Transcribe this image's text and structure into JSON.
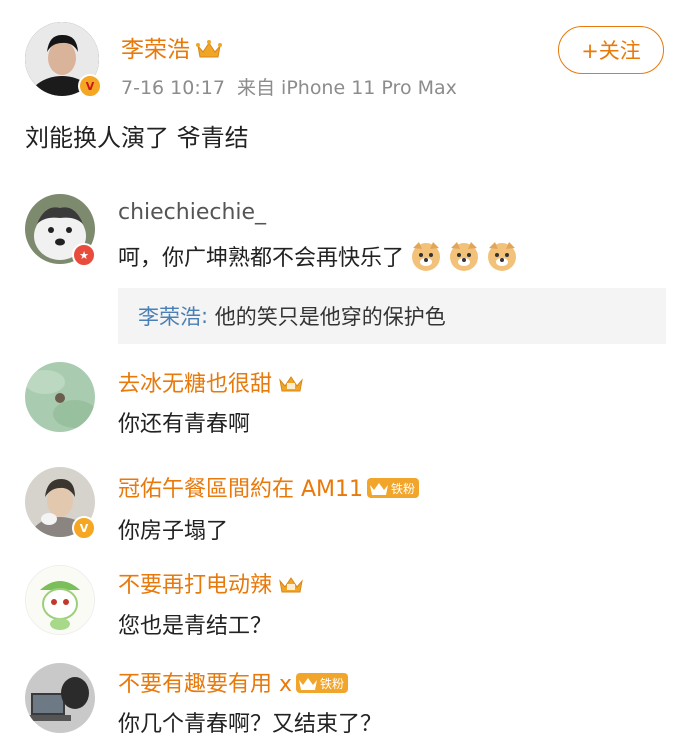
{
  "post": {
    "author": "李荣浩",
    "meta": "7-16 10:17  来自 iPhone 11 Pro Max",
    "follow_label": "+关注",
    "content": "刘能换人演了 爷青结"
  },
  "comments": [
    {
      "name": "chiechiechie_",
      "text": "呵，你广坤熟都不会再快乐了"
    },
    {
      "name": "去冰无糖也很甜",
      "text": "你还有青春啊"
    },
    {
      "name": "冠佑午餐區間約在 AM11",
      "text": "你房子塌了"
    },
    {
      "name": "不要再打电动辣",
      "text": "您也是青结工？"
    },
    {
      "name": "不要有趣要有用 x",
      "text": "你几个青春啊？又结束了？"
    }
  ],
  "reply": {
    "name": "李荣浩",
    "sep": ": ",
    "text": "他的笑只是他穿的保护色"
  },
  "fan_badge_label": "铁粉",
  "colors": {
    "name": "#e8790b",
    "reply_name": "#4a7fb5",
    "reply_bg": "#f4f4f4"
  }
}
